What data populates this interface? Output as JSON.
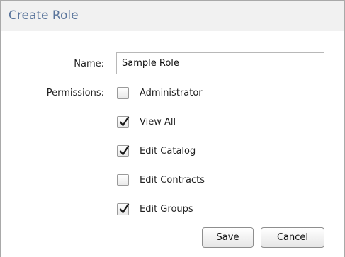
{
  "dialog": {
    "title": "Create Role"
  },
  "form": {
    "name_label": "Name:",
    "name_value": "Sample Role",
    "permissions_label": "Permissions:"
  },
  "permissions": [
    {
      "label": "Administrator",
      "checked": false
    },
    {
      "label": "View All",
      "checked": true
    },
    {
      "label": "Edit Catalog",
      "checked": true
    },
    {
      "label": "Edit Contracts",
      "checked": false
    },
    {
      "label": "Edit Groups",
      "checked": true
    }
  ],
  "buttons": {
    "save_label": "Save",
    "cancel_label": "Cancel"
  },
  "colors": {
    "title": "#59749b",
    "header_bg": "#f1f1f1",
    "border": "#a9a9a9"
  },
  "icons": {
    "check": "checkmark-icon"
  }
}
